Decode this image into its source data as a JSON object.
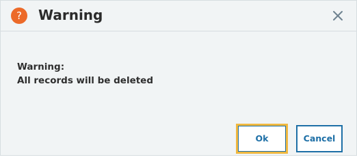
{
  "dialog": {
    "title": "Warning",
    "icon": "question-icon",
    "icon_glyph": "?",
    "icon_color": "#ec6a29",
    "message_line1": "Warning:",
    "message_line2": "All records will be deleted"
  },
  "buttons": {
    "ok_label": "Ok",
    "cancel_label": "Cancel",
    "accent_color": "#1d6fa6",
    "focus_color": "#f0b840"
  }
}
